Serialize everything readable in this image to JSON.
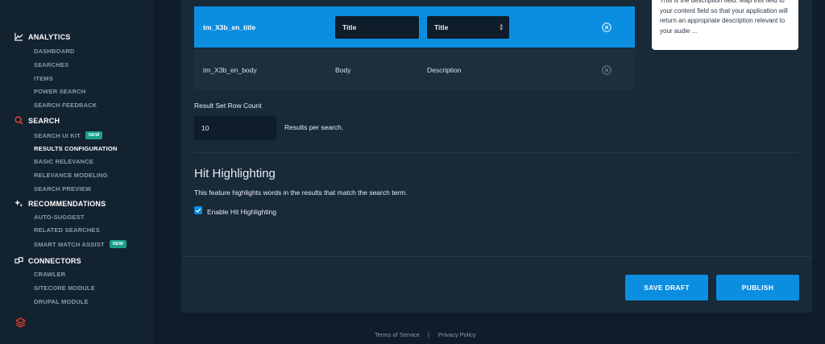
{
  "sidebar": {
    "analytics": {
      "label": "ANALYTICS",
      "items": [
        "DASHBOARD",
        "SEARCHES",
        "ITEMS",
        "POWER SEARCH",
        "SEARCH FEEDBACK"
      ]
    },
    "search": {
      "label": "SEARCH",
      "items": [
        "SEARCH UI KIT",
        "RESULTS CONFIGURATION",
        "BASIC RELEVANCE",
        "RELEVANCE MODELING",
        "SEARCH PREVIEW"
      ],
      "active": "RESULTS CONFIGURATION",
      "new_badge": "NEW"
    },
    "recommendations": {
      "label": "RECOMMENDATIONS",
      "items": [
        "AUTO-SUGGEST",
        "RELATED SEARCHES",
        "SMART MATCH ASSIST"
      ],
      "new_badge": "NEW"
    },
    "connectors": {
      "label": "CONNECTORS",
      "items": [
        "CRAWLER",
        "SITECORE MODULE",
        "DRUPAL MODULE"
      ]
    },
    "icons": {
      "analytics": "chart-icon",
      "search": "search-icon",
      "recommendations": "sparkle-icon",
      "connectors": "plug-icon",
      "footer": "layers-icon"
    }
  },
  "mapping": {
    "rows": [
      {
        "field": "tm_X3b_en_title",
        "name_value": "Title",
        "type_value": "Title"
      },
      {
        "field": "tm_X3b_en_body",
        "name_value": "Body",
        "type_value": "Description"
      }
    ]
  },
  "description_card": {
    "text": "This is the description field. Map this field to your content field so that your application will return an appropriate description relevant to your audie ..."
  },
  "result_count": {
    "label": "Result Set Row Count",
    "value": "10",
    "suffix": "Results per search."
  },
  "hit_highlighting": {
    "title": "Hit Highlighting",
    "description": "This feature highlights words in the results that match the search term.",
    "checkbox_label": "Enable Hit Highlighting",
    "checked": true
  },
  "actions": {
    "save_draft": "SAVE DRAFT",
    "publish": "PUBLISH"
  },
  "footer": {
    "terms": "Terms of Service",
    "separator": "|",
    "privacy": "Privacy Policy"
  },
  "colors": {
    "accent": "#0b8ee0",
    "badge": "#1a9e88",
    "search_icon": "#e8452c",
    "background": "#0f1d2a"
  }
}
